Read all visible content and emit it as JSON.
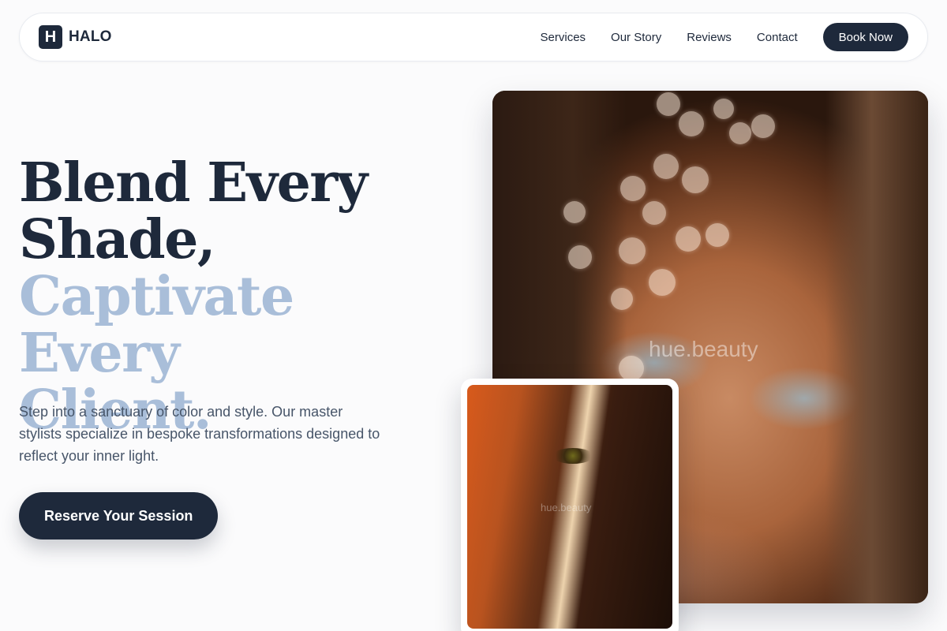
{
  "nav": {
    "logo_letter": "H",
    "brand": "HALO",
    "links": [
      "Services",
      "Our Story",
      "Reviews",
      "Contact"
    ],
    "cta": "Book Now"
  },
  "hero": {
    "title_line1": "Blend Every",
    "title_line2": "Shade,",
    "title_line3": "Captivate Every",
    "title_line4": "Client.",
    "subtitle": "Step into a sanctuary of color and style. Our master stylists specialize in bespoke transformations designed to reflect your inner light.",
    "cta": "Reserve Your Session"
  },
  "images": {
    "main_watermark": "hue.beauty",
    "secondary_watermark": "hue.beauty"
  },
  "colors": {
    "primary": "#1e293b",
    "accent_light": "#a9bed9",
    "muted_text": "#475569",
    "background": "#fbfbfc"
  }
}
